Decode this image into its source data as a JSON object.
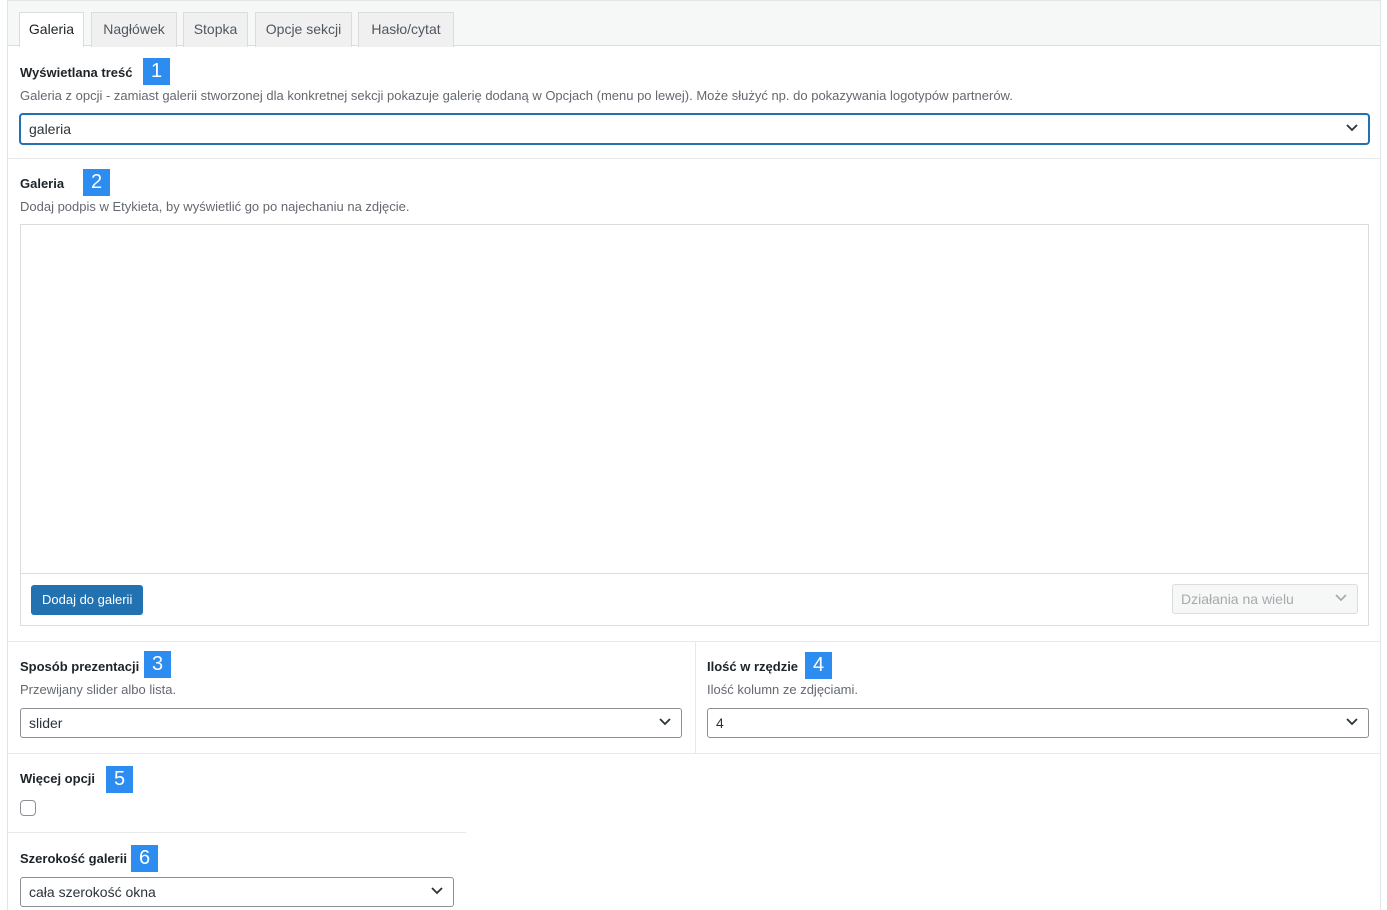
{
  "tabs": [
    {
      "label": "Galeria",
      "active": true
    },
    {
      "label": "Nagłówek",
      "active": false
    },
    {
      "label": "Stopka",
      "active": false
    },
    {
      "label": "Opcje sekcji",
      "active": false
    },
    {
      "label": "Hasło/cytat",
      "active": false
    }
  ],
  "content_field": {
    "label": "Wyświetlana treść",
    "badge": "1",
    "description": "Galeria z opcji - zamiast galerii stworzonej dla konkretnej sekcji pokazuje galerię dodaną w Opcjach (menu po lewej). Może służyć np. do pokazywania logotypów partnerów.",
    "value": "galeria"
  },
  "gallery_field": {
    "label": "Galeria",
    "badge": "2",
    "description": "Dodaj podpis w Etykieta, by wyświetlić go po najechaniu na zdjęcie.",
    "add_button": "Dodaj do galerii",
    "bulk_actions": "Działania na wielu"
  },
  "presentation_field": {
    "label": "Sposób prezentacji",
    "badge": "3",
    "description": "Przewijany slider albo lista.",
    "value": "slider"
  },
  "columns_field": {
    "label": "Ilość w rzędzie",
    "badge": "4",
    "description": "Ilość kolumn ze zdjęciami.",
    "value": "4"
  },
  "more_options_field": {
    "label": "Więcej opcji",
    "badge": "5",
    "checked": false
  },
  "width_field": {
    "label": "Szerokość galerii",
    "badge": "6",
    "value": "cała szerokość okna"
  },
  "colors": {
    "accent": "#2271b1",
    "badge": "#2d8cf0"
  },
  "icons": [
    "chevron-down-icon"
  ]
}
